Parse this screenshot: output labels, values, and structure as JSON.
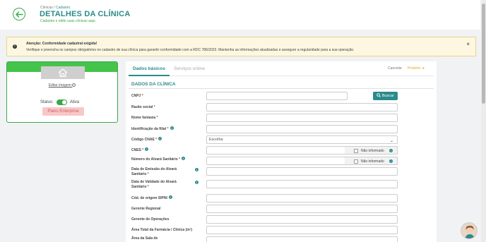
{
  "header": {
    "breadcrumb_root": "Clínicas /",
    "breadcrumb_current": "Cadastro",
    "title": "DETALHES DA CLÍNICA",
    "subtitle": "Cadastre e edite suas clínicas aqui."
  },
  "alert": {
    "title": "Atenção: Conformidade cadastral exigida!",
    "message": "Verifique e preencha os campos obrigatórios no cadastro de sua clínica para garantir conformidade com a RDC 786/2023. Mantenha as informações atualizadas e assegure a regularidade para a sua operação.",
    "close": "×"
  },
  "clinic_card": {
    "edit_image": "Editar imagem",
    "status_label": "Status:",
    "status_value": "Ativa",
    "plan": "Plano Enterprise"
  },
  "tabs": [
    {
      "label": "Dados básicos",
      "active": true
    },
    {
      "label": "Serviços online",
      "active": false
    }
  ],
  "actions": {
    "cancel": "Cancelar",
    "next": "Próximo ➔"
  },
  "section_title": "DADOS DA CLÍNICA",
  "search_button": "Buscar",
  "select_value": "Escolha",
  "nao_informado": "Não informado",
  "fields": [
    {
      "label": "CNPJ",
      "required": true,
      "info": false
    },
    {
      "label": "Razão social",
      "required": true,
      "info": false
    },
    {
      "label": "Nome fantasia",
      "required": true,
      "info": false
    },
    {
      "label": "Identificação da filial",
      "required": true,
      "info": true
    },
    {
      "label": "Código CNAE",
      "required": true,
      "info": true
    },
    {
      "label": "CNES",
      "required": true,
      "info": true
    },
    {
      "label": "Número do Alvará Sanitário",
      "required": true,
      "info": true
    },
    {
      "label_line1": "Data de Emissão do Alvará",
      "label_line2": "Sanitário",
      "required": true,
      "info": true
    },
    {
      "label_line1": "Data de Validade do Alvará",
      "label_line2": "Sanitário",
      "required": true,
      "info": true
    },
    {
      "label": "Cód. de origem SIPNI",
      "required": false,
      "info": true
    },
    {
      "label": "Gerente Regional",
      "required": false,
      "info": false
    },
    {
      "label": "Gerente de Operações",
      "required": false,
      "info": false
    },
    {
      "label": "Área Total da Farmácia / Clínica (m²)",
      "required": false,
      "info": false
    },
    {
      "label_line1": "Área da Sala de",
      "required": false,
      "info": false
    }
  ],
  "colors": {
    "brand": "#2c8a8a",
    "accent_green": "#3aa84a",
    "next_orange": "#e8a21a",
    "alert_bg": "#fdf7e1"
  }
}
